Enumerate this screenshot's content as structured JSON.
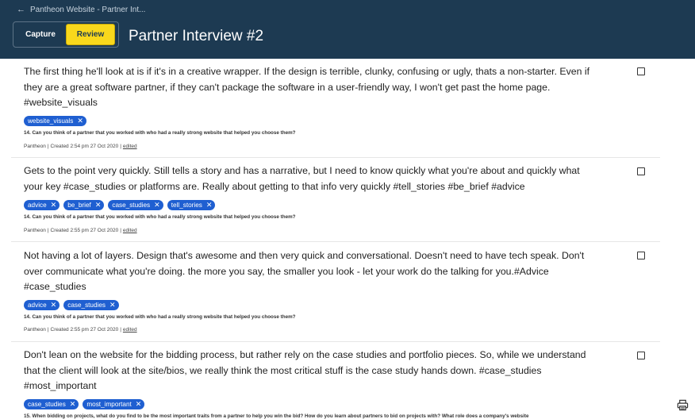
{
  "header": {
    "back_label": "Pantheon Website - Partner Int...",
    "modes": {
      "capture": "Capture",
      "review": "Review",
      "active": "Review"
    },
    "title": "Partner Interview #2",
    "background": "#1d3a52",
    "accent": "#f9d81c"
  },
  "notes": [
    {
      "text": "The first thing he'll look at is if it's in a creative wrapper. If the design is terrible, clunky, confusing or ugly, thats a non-starter. Even if they are a great software partner, if they can't package the software in a user-friendly way, I won't get past the home page. #website_visuals",
      "tags": [
        "website_visuals"
      ],
      "question": "14. Can you think of a partner that you worked with who had a really strong website that helped you choose them?",
      "author": "Pantheon",
      "created": "Created 2:54 pm 27 Oct 2020",
      "edited": "edited"
    },
    {
      "text": "Gets to the point very quickly. Still tells a story and has a narrative, but I need to know quickly what you're about and quickly what your key #case_studies or platforms are. Really about getting to that info very quickly #tell_stories #be_brief #advice",
      "tags": [
        "advice",
        "be_brief",
        "case_studies",
        "tell_stories"
      ],
      "question": "14. Can you think of a partner that you worked with who had a really strong website that helped you choose them?",
      "author": "Pantheon",
      "created": "Created 2:55 pm 27 Oct 2020",
      "edited": "edited"
    },
    {
      "text": "Not having a lot of layers. Design that's awesome and then very quick and conversational. Doesn't need to have tech speak. Don't over communicate what you're doing. the more you say, the smaller you look - let your work do the talking for you.#Advice #case_studies",
      "tags": [
        "advice",
        "case_studies"
      ],
      "question": "14. Can you think of a partner that you worked with who had a really strong website that helped you choose them?",
      "author": "Pantheon",
      "created": "Created 2:55 pm 27 Oct 2020",
      "edited": "edited"
    },
    {
      "text": "Don't lean on the website for the bidding process, but rather rely on the case studies and portfolio pieces. So, while we understand that the client will look at the site/bios, we really think the most critical stuff is the case study hands down. #case_studies #most_important",
      "tags": [
        "case_studies",
        "most_important"
      ],
      "question": "15. When bidding on projects, what do you find to be the most important traits from a partner to help you win the bid? How do you learn about partners to bid on projects with? What role does a company's website",
      "author": "",
      "created": "",
      "edited": ""
    }
  ],
  "icons": {
    "back": "arrow-left-icon",
    "tag_remove": "close-icon",
    "checkbox": "checkbox-icon",
    "print": "printer-icon"
  },
  "tag_color": "#1f5fd1"
}
